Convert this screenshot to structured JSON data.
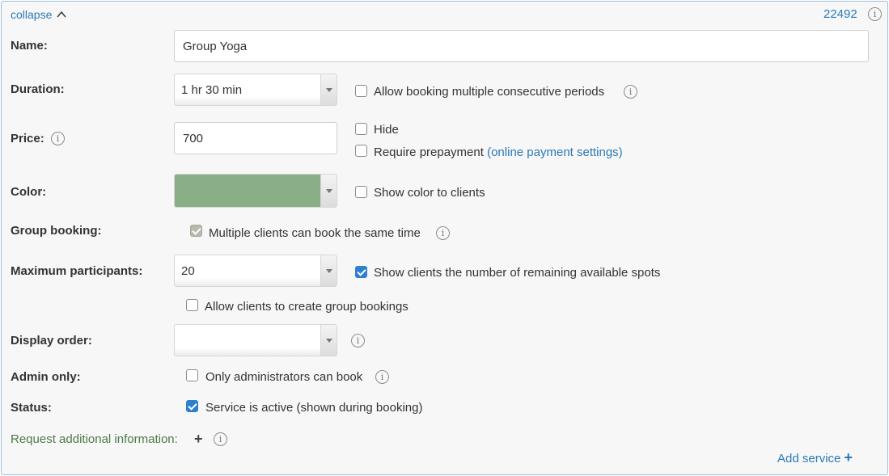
{
  "header": {
    "collapse_label": "collapse",
    "collapse_icon": "chevron-up-icon",
    "service_id": "22492"
  },
  "fields": {
    "name": {
      "label": "Name:",
      "value": "Group Yoga"
    },
    "duration": {
      "label": "Duration:",
      "value": "1 hr 30 min",
      "multi_period_label": "Allow booking multiple consecutive periods",
      "multi_period_checked": false
    },
    "price": {
      "label": "Price:",
      "value": "700",
      "hide_label": "Hide",
      "hide_checked": false,
      "prepay_label": "Require prepayment",
      "prepay_link": "(online payment settings)",
      "prepay_checked": false
    },
    "color": {
      "label": "Color:",
      "value": "#8aaf87",
      "show_label": "Show color to clients",
      "show_checked": false
    },
    "group_booking": {
      "label": "Group booking:",
      "option_label": "Multiple clients can book the same time",
      "option_checked": true
    },
    "max_participants": {
      "label": "Maximum participants:",
      "value": "20",
      "show_remaining_label": "Show clients the number of remaining available spots",
      "show_remaining_checked": true,
      "allow_create_label": "Allow clients to create group bookings",
      "allow_create_checked": false
    },
    "display_order": {
      "label": "Display order:",
      "value": ""
    },
    "admin_only": {
      "label": "Admin only:",
      "option_label": "Only administrators can book",
      "option_checked": false
    },
    "status": {
      "label": "Status:",
      "option_label": "Service is active (shown during booking)",
      "option_checked": true
    }
  },
  "footer": {
    "request_info_label": "Request additional information:",
    "add_service_label": "Add service"
  },
  "colors": {
    "link": "#2a79b7",
    "green_text": "#4c7a47",
    "checkbox_checked": "#2f7fd0",
    "border": "#9bbfd9"
  }
}
